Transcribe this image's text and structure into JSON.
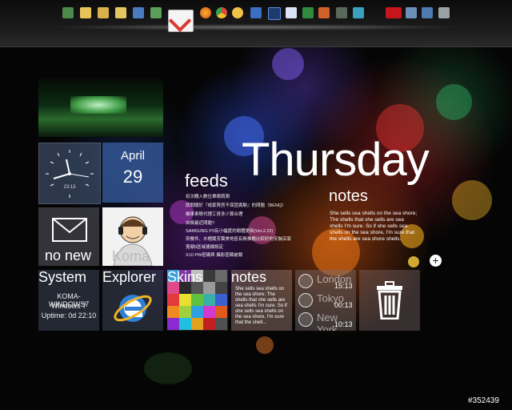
{
  "dock": {
    "icons": [
      "desktop-icon",
      "folder-icon",
      "documents-icon",
      "folder-icon",
      "network-icon",
      "recycle-icon",
      "gmail-icon",
      "firefox-icon",
      "chrome-icon",
      "opera-icon",
      "media-player-icon",
      "monitor-icon",
      "photoshop-icon",
      "word-icon",
      "excel-icon",
      "powerpoint-icon",
      "app-icon",
      "utility-icon",
      "ati-icon",
      "laptop-icon",
      "display-icon",
      "trash-icon"
    ],
    "colors": {
      "accent": "#d73a2e"
    }
  },
  "tiles": {
    "calendar": {
      "month": "April",
      "day": "29"
    },
    "clock": {
      "time": "23:13"
    },
    "mail": {
      "label": "no new"
    },
    "avatar": {
      "name": "Koma"
    },
    "system": {
      "title": "System",
      "host": "KOMA-WINDOWS7",
      "os": "Windows 7",
      "uptime": "Uptime: 0d 22:10"
    },
    "explorer": {
      "title": "Explorer"
    },
    "skins": {
      "title": "Skins"
    },
    "notes_small": {
      "title": "notes",
      "text": "She sells sea shells on the sea shore; The shells that she sells are sea shells I'm sure. So if she sells sea shells on the sea shore, I'm sure that the shell..."
    },
    "world_clock": [
      {
        "city": "London",
        "time": "15:13"
      },
      {
        "city": "Tokyo",
        "time": "00:13"
      },
      {
        "city": "New York",
        "time": "10:13"
      }
    ]
  },
  "feeds": {
    "title": "feeds",
    "items": [
      "初次購入數位單眼請測",
      "請問關於『成家買房不保固責駭』的問題（BENQ）",
      "機車車險代理工資多少算合理",
      "自娛最近問題?",
      "SAMSUNG P3有小幅度的韌體更新(Ver.2.22)",
      "煎餐件、木桶蘭芳葉美地區有無推薦比較好的安裝店家",
      "寬頻5區域連線設定",
      "X10 PW密碼與 攝影密碼被鎖"
    ]
  },
  "day": "Thursday",
  "notes": {
    "title": "notes",
    "text": "She sells sea shells on the sea shore; The shells that she sells are sea shells I'm sure. So if she sells sea shells on the sea shore, I'm sure that the shells are sea shore shells."
  },
  "watermark": "#352439"
}
